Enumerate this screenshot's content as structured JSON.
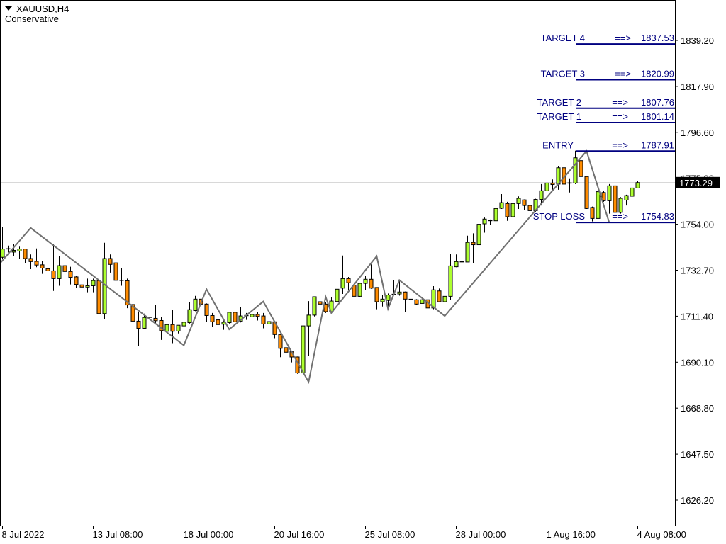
{
  "header": {
    "symbol": "XAUUSD,H4",
    "indicator": "Conservative"
  },
  "colors": {
    "bull": "#adff2f",
    "bear": "#ff8c00",
    "level": "#000080",
    "zigzag": "#707070",
    "bid_line": "#c0c0c0"
  },
  "chart_data": {
    "type": "candlestick",
    "title": "XAUUSD,H4",
    "ylim": [
      1620,
      1849
    ],
    "y_ticks": [
      "1839.20",
      "1817.90",
      "1796.60",
      "1775.30",
      "1754.00",
      "1732.70",
      "1711.40",
      "1690.10",
      "1668.80",
      "1647.50",
      "1626.20"
    ],
    "x_ticks": [
      {
        "bar": 1,
        "label": "8 Jul 2022"
      },
      {
        "bar": 17,
        "label": "13 Jul 08:00"
      },
      {
        "bar": 33,
        "label": "18 Jul 00:00"
      },
      {
        "bar": 49,
        "label": "20 Jul 16:00"
      },
      {
        "bar": 65,
        "label": "25 Jul 08:00"
      },
      {
        "bar": 81,
        "label": "28 Jul 00:00"
      },
      {
        "bar": 97,
        "label": "1 Aug 16:00"
      },
      {
        "bar": 113,
        "label": "4 Aug 08:00"
      }
    ],
    "current_price": "1773.29",
    "candles_ohlc": [
      [
        1738.7,
        1752.9,
        1738.1,
        1742.5
      ],
      [
        1742.5,
        1744.1,
        1740.9,
        1742.6
      ],
      [
        1741.1,
        1744.7,
        1739.2,
        1741.9
      ],
      [
        1741.6,
        1743.6,
        1738.1,
        1742.5
      ],
      [
        1742.5,
        1742.5,
        1735.9,
        1738.1
      ],
      [
        1738.1,
        1740.0,
        1733.2,
        1736.7
      ],
      [
        1736.8,
        1742.8,
        1734.1,
        1735.1
      ],
      [
        1735.2,
        1736.8,
        1731.0,
        1733.7
      ],
      [
        1733.4,
        1735.9,
        1731.6,
        1732.4
      ],
      [
        1732.4,
        1744.7,
        1723.1,
        1728.8
      ],
      [
        1728.8,
        1739.2,
        1725.5,
        1734.8
      ],
      [
        1734.8,
        1737.8,
        1730.7,
        1732.1
      ],
      [
        1732.1,
        1734.3,
        1726.1,
        1729.4
      ],
      [
        1729.6,
        1729.9,
        1724.4,
        1726.1
      ],
      [
        1725.9,
        1726.6,
        1722.5,
        1724.9
      ],
      [
        1724.9,
        1728.8,
        1722.5,
        1725.5
      ],
      [
        1725.5,
        1728.8,
        1722.5,
        1727.9
      ],
      [
        1727.9,
        1731.9,
        1706.7,
        1712.6
      ],
      [
        1712.6,
        1745.4,
        1710.2,
        1738.1
      ],
      [
        1738.1,
        1740.0,
        1731.6,
        1735.4
      ],
      [
        1736.1,
        1736.5,
        1727.5,
        1728.0
      ],
      [
        1728.0,
        1733.5,
        1725.5,
        1727.8
      ],
      [
        1727.8,
        1728.8,
        1715.1,
        1716.6
      ],
      [
        1716.8,
        1717.3,
        1707.5,
        1709.1
      ],
      [
        1709.1,
        1713.5,
        1697.6,
        1705.8
      ],
      [
        1705.8,
        1712.6,
        1705.6,
        1710.8
      ],
      [
        1710.8,
        1711.9,
        1710.0,
        1710.9
      ],
      [
        1710.4,
        1716.8,
        1708.0,
        1709.3
      ],
      [
        1709.4,
        1710.9,
        1700.4,
        1704.7
      ],
      [
        1704.4,
        1707.8,
        1699.8,
        1707.5
      ],
      [
        1707.5,
        1714.3,
        1698.9,
        1704.4
      ],
      [
        1704.5,
        1707.2,
        1703.4,
        1707.2
      ],
      [
        1706.9,
        1711.3,
        1706.4,
        1708.6
      ],
      [
        1708.4,
        1717.9,
        1708.0,
        1714.4
      ],
      [
        1714.0,
        1720.8,
        1713.7,
        1719.3
      ],
      [
        1719.3,
        1723.3,
        1711.3,
        1717.0
      ],
      [
        1717.0,
        1717.3,
        1708.6,
        1711.7
      ],
      [
        1711.7,
        1712.9,
        1706.4,
        1708.8
      ],
      [
        1709.7,
        1710.4,
        1705.1,
        1707.5
      ],
      [
        1707.7,
        1710.2,
        1705.1,
        1708.6
      ],
      [
        1708.4,
        1713.5,
        1708.0,
        1713.2
      ],
      [
        1713.2,
        1718.4,
        1708.5,
        1708.8
      ],
      [
        1709.1,
        1715.5,
        1708.5,
        1711.5
      ],
      [
        1711.6,
        1712.9,
        1709.7,
        1711.7
      ],
      [
        1711.1,
        1713.3,
        1709.4,
        1712.2
      ],
      [
        1712.2,
        1713.3,
        1709.4,
        1711.3
      ],
      [
        1711.5,
        1712.9,
        1705.8,
        1707.8
      ],
      [
        1707.8,
        1714.6,
        1706.0,
        1708.9
      ],
      [
        1708.8,
        1708.9,
        1701.2,
        1702.9
      ],
      [
        1702.9,
        1703.1,
        1692.4,
        1696.5
      ],
      [
        1696.8,
        1697.1,
        1691.8,
        1694.7
      ],
      [
        1694.9,
        1695.4,
        1690.0,
        1692.5
      ],
      [
        1692.5,
        1692.7,
        1684.7,
        1685.1
      ],
      [
        1685.1,
        1707.2,
        1680.7,
        1706.9
      ],
      [
        1706.9,
        1718.4,
        1693.0,
        1711.9
      ],
      [
        1711.9,
        1720.4,
        1711.3,
        1720.4
      ],
      [
        1718.1,
        1719.0,
        1716.8,
        1717.0
      ],
      [
        1717.0,
        1717.9,
        1712.9,
        1713.5
      ],
      [
        1713.5,
        1720.3,
        1713.0,
        1718.4
      ],
      [
        1718.2,
        1730.1,
        1717.9,
        1723.9
      ],
      [
        1724.4,
        1739.5,
        1721.7,
        1728.8
      ],
      [
        1728.8,
        1729.6,
        1723.4,
        1726.9
      ],
      [
        1725.8,
        1726.8,
        1720.4,
        1720.6
      ],
      [
        1720.6,
        1726.8,
        1720.1,
        1726.6
      ],
      [
        1726.6,
        1730.1,
        1723.4,
        1728.5
      ],
      [
        1728.5,
        1735.4,
        1724.1,
        1724.4
      ],
      [
        1724.7,
        1724.7,
        1714.6,
        1718.1
      ],
      [
        1718.1,
        1721.2,
        1715.9,
        1719.3
      ],
      [
        1718.7,
        1721.9,
        1715.2,
        1721.2
      ],
      [
        1721.4,
        1728.2,
        1721.2,
        1721.5
      ],
      [
        1721.7,
        1727.7,
        1720.9,
        1722.6
      ],
      [
        1722.6,
        1722.8,
        1713.5,
        1719.3
      ],
      [
        1719.2,
        1722.0,
        1714.3,
        1719.2
      ],
      [
        1719.0,
        1719.3,
        1716.6,
        1717.0
      ],
      [
        1717.3,
        1719.2,
        1717.3,
        1719.0
      ],
      [
        1719.0,
        1719.5,
        1713.7,
        1715.2
      ],
      [
        1715.2,
        1725.3,
        1714.6,
        1723.6
      ],
      [
        1723.1,
        1724.2,
        1717.9,
        1718.1
      ],
      [
        1718.1,
        1721.4,
        1711.9,
        1720.6
      ],
      [
        1720.6,
        1740.3,
        1719.0,
        1734.7
      ],
      [
        1734.3,
        1740.0,
        1734.1,
        1736.7
      ],
      [
        1736.6,
        1738.7,
        1736.5,
        1736.6
      ],
      [
        1736.5,
        1748.7,
        1736.5,
        1745.6
      ],
      [
        1745.6,
        1749.8,
        1735.9,
        1744.5
      ],
      [
        1744.5,
        1754.2,
        1740.9,
        1754.0
      ],
      [
        1754.2,
        1757.1,
        1750.1,
        1756.4
      ],
      [
        1755.6,
        1756.2,
        1753.8,
        1755.7
      ],
      [
        1755.6,
        1764.4,
        1752.3,
        1761.3
      ],
      [
        1761.4,
        1768.0,
        1761.1,
        1764.0
      ],
      [
        1763.6,
        1764.4,
        1755.6,
        1757.5
      ],
      [
        1757.5,
        1767.7,
        1751.8,
        1763.6
      ],
      [
        1763.6,
        1766.9,
        1761.1,
        1766.0
      ],
      [
        1765.3,
        1765.5,
        1760.5,
        1762.7
      ],
      [
        1762.7,
        1765.1,
        1760.0,
        1760.3
      ],
      [
        1760.3,
        1765.8,
        1759.5,
        1765.5
      ],
      [
        1765.5,
        1772.6,
        1762.7,
        1769.5
      ],
      [
        1769.5,
        1775.5,
        1768.0,
        1773.1
      ],
      [
        1773.0,
        1774.8,
        1769.3,
        1772.4
      ],
      [
        1772.6,
        1780.8,
        1770.0,
        1780.2
      ],
      [
        1780.2,
        1780.4,
        1767.7,
        1772.6
      ],
      [
        1772.7,
        1775.3,
        1768.7,
        1773.1
      ],
      [
        1773.1,
        1788.1,
        1772.6,
        1784.8
      ],
      [
        1783.5,
        1786.2,
        1773.1,
        1776.1
      ],
      [
        1776.1,
        1776.4,
        1761.1,
        1761.3
      ],
      [
        1761.8,
        1762.2,
        1755.3,
        1756.7
      ],
      [
        1756.7,
        1772.6,
        1755.3,
        1769.1
      ],
      [
        1768.7,
        1769.3,
        1764.4,
        1764.9
      ],
      [
        1764.9,
        1772.6,
        1758.9,
        1771.8
      ],
      [
        1771.8,
        1772.6,
        1754.5,
        1759.5
      ],
      [
        1759.5,
        1766.6,
        1758.9,
        1766.0
      ],
      [
        1765.2,
        1767.7,
        1762.7,
        1767.3
      ],
      [
        1767.0,
        1771.4,
        1765.8,
        1770.8
      ],
      [
        1770.8,
        1773.9,
        1770.6,
        1773.29
      ]
    ],
    "zigzag": [
      {
        "bar": 0.6,
        "price": 1735.9
      },
      {
        "bar": 6,
        "price": 1752.3
      },
      {
        "bar": 33,
        "price": 1697.9
      },
      {
        "bar": 37,
        "price": 1723.9
      },
      {
        "bar": 41,
        "price": 1705.3
      },
      {
        "bar": 47,
        "price": 1718.2
      },
      {
        "bar": 55,
        "price": 1680.9
      },
      {
        "bar": 58,
        "price": 1720.4
      },
      {
        "bar": 59,
        "price": 1712.9
      },
      {
        "bar": 67,
        "price": 1739.2
      },
      {
        "bar": 69,
        "price": 1714.8
      },
      {
        "bar": 71,
        "price": 1728.1
      },
      {
        "bar": 79,
        "price": 1711.5
      },
      {
        "bar": 104,
        "price": 1787.9
      },
      {
        "bar": 108,
        "price": 1754.8
      }
    ],
    "levels": [
      {
        "label": "TARGET 4",
        "arrow": "==>",
        "value": "1837.53"
      },
      {
        "label": "TARGET 3",
        "arrow": "==>",
        "value": "1820.99"
      },
      {
        "label": "TARGET 2",
        "arrow": "==>",
        "value": "1807.76"
      },
      {
        "label": "TARGET 1",
        "arrow": "==>",
        "value": "1801.14"
      },
      {
        "label": "ENTRY",
        "arrow": "==>",
        "value": "1787.91"
      },
      {
        "label": "STOP LOSS",
        "arrow": "==>",
        "value": "1754.83"
      }
    ]
  }
}
